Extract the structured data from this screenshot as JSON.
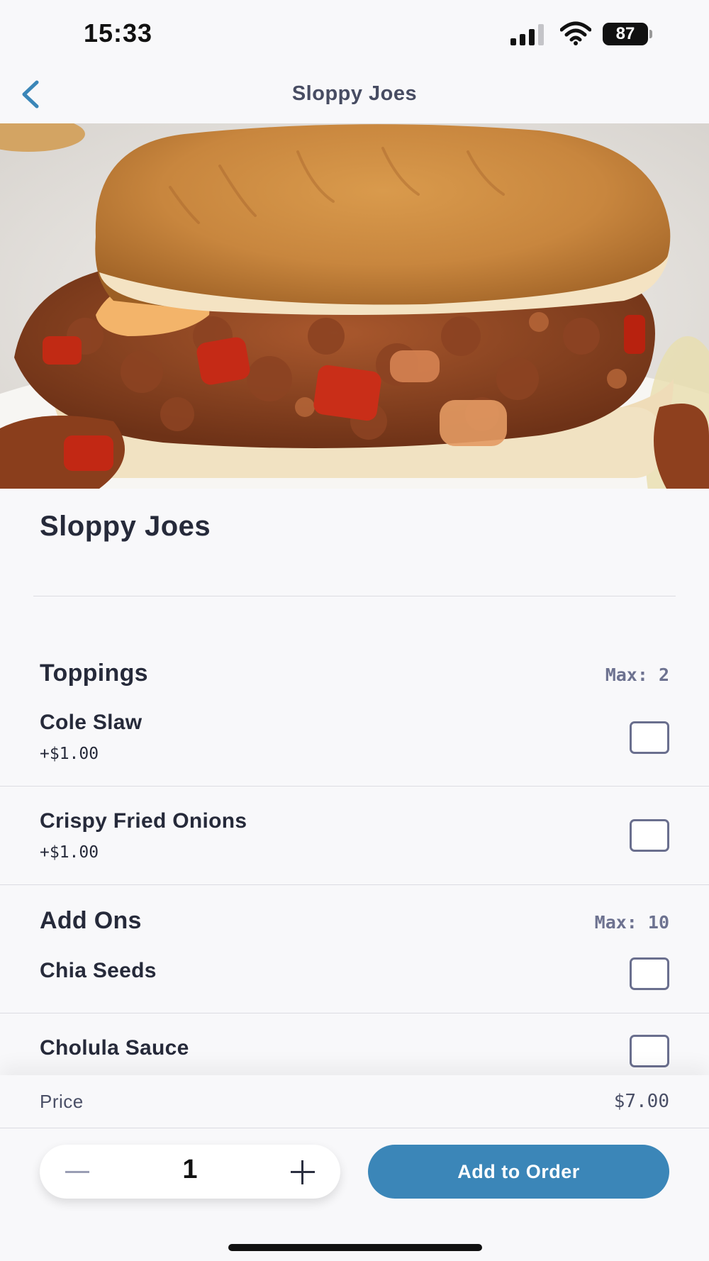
{
  "status_bar": {
    "time": "15:33",
    "battery": "87",
    "icons": [
      "signal-icon",
      "wifi-icon",
      "battery-icon"
    ]
  },
  "nav": {
    "back_icon": "chevron-left-icon",
    "title": "Sloppy Joes",
    "accent": "#3b86b8"
  },
  "item": {
    "title": "Sloppy Joes"
  },
  "sections": [
    {
      "title": "Toppings",
      "max": "Max: 2",
      "options": [
        {
          "name": "Cole Slaw",
          "price": "+$1.00",
          "checked": false
        },
        {
          "name": "Crispy Fried Onions",
          "price": "+$1.00",
          "checked": false
        }
      ]
    },
    {
      "title": "Add Ons",
      "max": "Max: 10",
      "options": [
        {
          "name": "Chia Seeds",
          "checked": false
        },
        {
          "name": "Cholula Sauce",
          "checked": false
        }
      ]
    }
  ],
  "summary": {
    "price_label": "Price",
    "price_value": "$7.00"
  },
  "quantity": {
    "value": "1",
    "minus_icon": "minus-icon",
    "plus_icon": "plus-icon"
  },
  "actions": {
    "add_label": "Add to Order",
    "add_color": "#3b86b8"
  }
}
